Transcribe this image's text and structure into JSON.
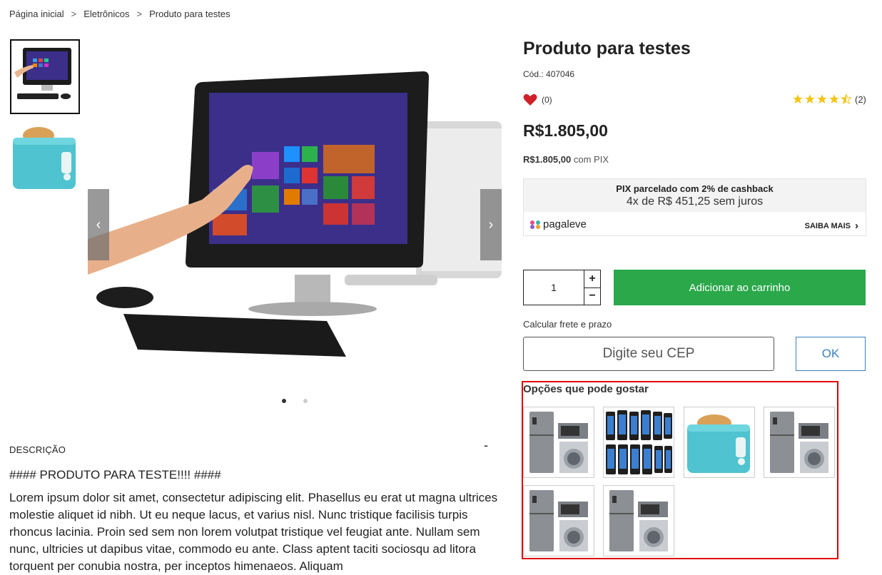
{
  "breadcrumb": {
    "items": [
      "Página inicial",
      "Eletrônicos",
      "Produto para testes"
    ],
    "separator": ">"
  },
  "product": {
    "title": "Produto para testes",
    "sku": "Cód.: 407046",
    "favorites_count": "(0)",
    "rating": 4.5,
    "rating_count": "(2)",
    "price": "R$1.805,00",
    "pix_price": "R$1.805,00",
    "pix_suffix": "com PIX"
  },
  "pix_box": {
    "line1": "PIX parcelado com 2% de cashback",
    "line2": "4x de R$ 451,25 sem juros",
    "brand": "pagaleve",
    "cta": "SAIBA MAIS"
  },
  "cart": {
    "quantity": "1",
    "plus": "+",
    "minus": "−",
    "add_label": "Adicionar ao carrinho"
  },
  "shipping": {
    "label": "Calcular frete e prazo",
    "placeholder": "Digite seu CEP",
    "ok": "OK"
  },
  "description": {
    "label": "DESCRIÇÃO",
    "toggle": "-",
    "heading": "#### PRODUTO PARA TESTE!!!! ####",
    "body": "Lorem ipsum dolor sit amet, consectetur adipiscing elit. Phasellus eu erat ut magna ultrices molestie aliquet id nibh. Ut eu neque lacus, et varius nisl. Nunc tristique facilisis turpis rhoncus lacinia. Proin sed sem non lorem volutpat tristique vel feugiat ante. Nullam sem nunc, ultricies ut dapibus vitae, commodo eu ante. Class aptent taciti sociosqu ad litora torquent per conubia nostra, per inceptos himenaeos. Aliquam"
  },
  "options": {
    "title": "Opções que pode gostar"
  },
  "colors": {
    "accent_green": "#2aa84a",
    "ok_blue": "#3a7fc0",
    "highlight_red": "#e00000",
    "heart_red": "#d0212a",
    "star_gold": "#f5c518"
  }
}
